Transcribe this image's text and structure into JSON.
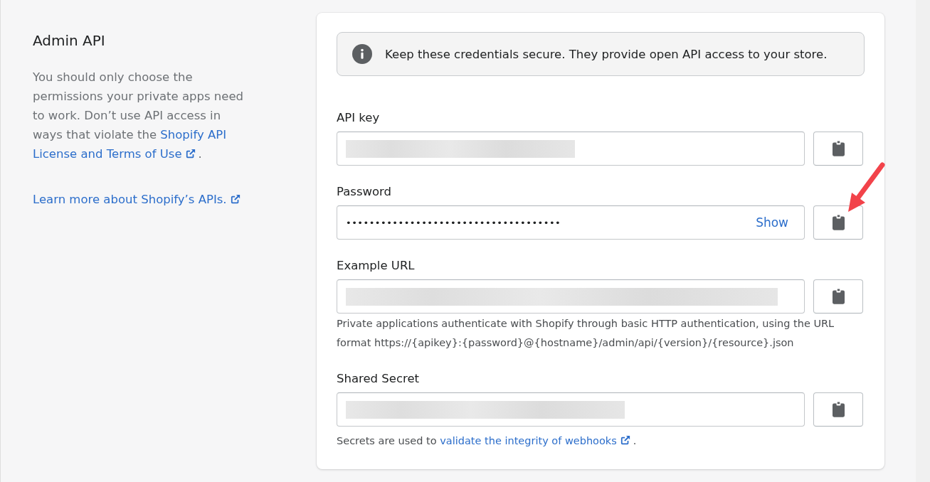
{
  "sidebar": {
    "title": "Admin API",
    "description": [
      {
        "kind": "text",
        "text": "You should only choose the permissions your private apps need to work. Don’t use API access in ways that violate the "
      },
      {
        "kind": "link",
        "text": "Shopify API"
      },
      {
        "kind": "external_link",
        "text": "License and Terms of Use"
      },
      {
        "kind": "text",
        "text": "."
      }
    ],
    "learn_more": {
      "kind": "external_link",
      "text": "Learn more about Shopify’s APIs."
    }
  },
  "card": {
    "notice": "Keep these credentials secure. They provide open API access to your store.",
    "fields": [
      {
        "label": "API key",
        "kind": "redacted",
        "annotated": false
      },
      {
        "label": "Password",
        "kind": "password",
        "value": "•••••••••••••••••••••••••••••••••••••",
        "reveal": "Show",
        "annotated": true
      },
      {
        "label": "Example URL",
        "kind": "redacted",
        "annotated": false,
        "help": [
          {
            "kind": "text",
            "text": "Private applications authenticate with Shopify through basic HTTP authentication, using the URL format https://{apikey}:{password}@{hostname}/admin/api/{version}/{resource}.json"
          }
        ]
      },
      {
        "label": "Shared Secret",
        "kind": "redacted",
        "annotated": false,
        "help": [
          {
            "kind": "text",
            "text": "Secrets are used to "
          },
          {
            "kind": "external_link",
            "text": "validate the integrity of webhooks"
          },
          {
            "kind": "text",
            "text": "."
          }
        ]
      }
    ]
  }
}
